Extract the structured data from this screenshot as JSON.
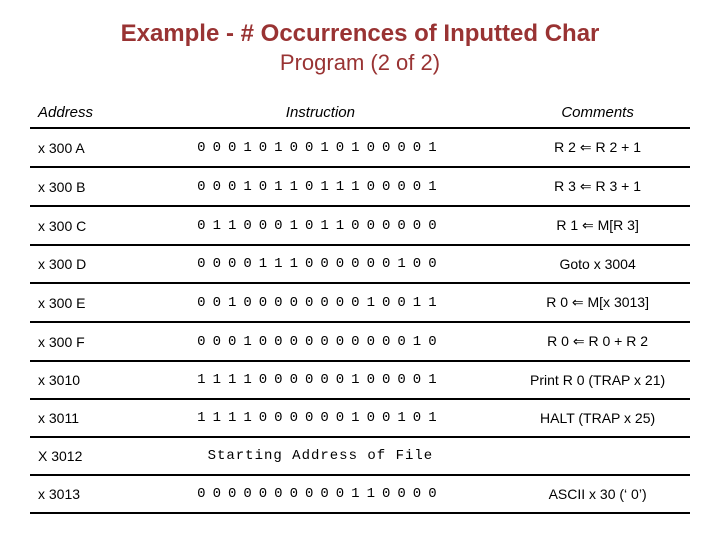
{
  "title": "Example - # Occurrences of Inputted Char",
  "subtitle": "Program (2 of 2)",
  "headers": {
    "address": "Address",
    "instruction": "Instruction",
    "comments": "Comments"
  },
  "rows": [
    {
      "address": "x 300 A",
      "instruction": "0 0 0 1 0 1 0 0 1 0 1 0 0 0 0 1",
      "comment": "R 2 ⇐ R 2 + 1"
    },
    {
      "address": "x 300 B",
      "instruction": "0 0 0 1 0 1 1 0 1 1 1 0 0 0 0 1",
      "comment": "R 3 ⇐ R 3 + 1"
    },
    {
      "address": "x 300 C",
      "instruction": "0 1 1 0 0 0 1 0 1 1 0 0 0 0 0 0",
      "comment": "R 1 ⇐ M[R 3]"
    },
    {
      "address": "x 300 D",
      "instruction": "0 0 0 0 1 1 1 0 0 0 0 0 0 1 0 0",
      "comment": "Goto x 3004"
    },
    {
      "address": "x 300 E",
      "instruction": "0 0 1 0 0 0 0 0 0 0 0 1 0 0 1 1",
      "comment": "R 0 ⇐ M[x 3013]"
    },
    {
      "address": "x 300 F",
      "instruction": "0 0 0 1 0 0 0 0 0 0 0 0 0 0 1 0",
      "comment": "R 0 ⇐ R 0 + R 2"
    },
    {
      "address": "x 3010",
      "instruction": "1 1 1 1 0 0 0 0 0 0 1 0 0 0 0 1",
      "comment": "Print R 0 (TRAP x 21)"
    },
    {
      "address": "x 3011",
      "instruction": "1 1 1 1 0 0 0 0 0 0 1 0 0 1 0 1",
      "comment": "HALT (TRAP x 25)"
    },
    {
      "address": "X 3012",
      "instruction": "Starting Address of File",
      "comment": "",
      "text": true
    },
    {
      "address": "x 3013",
      "instruction": "0 0 0 0 0 0 0 0 0 0 1 1 0 0 0 0",
      "comment": "ASCII x 30 (‘ 0’)"
    }
  ]
}
